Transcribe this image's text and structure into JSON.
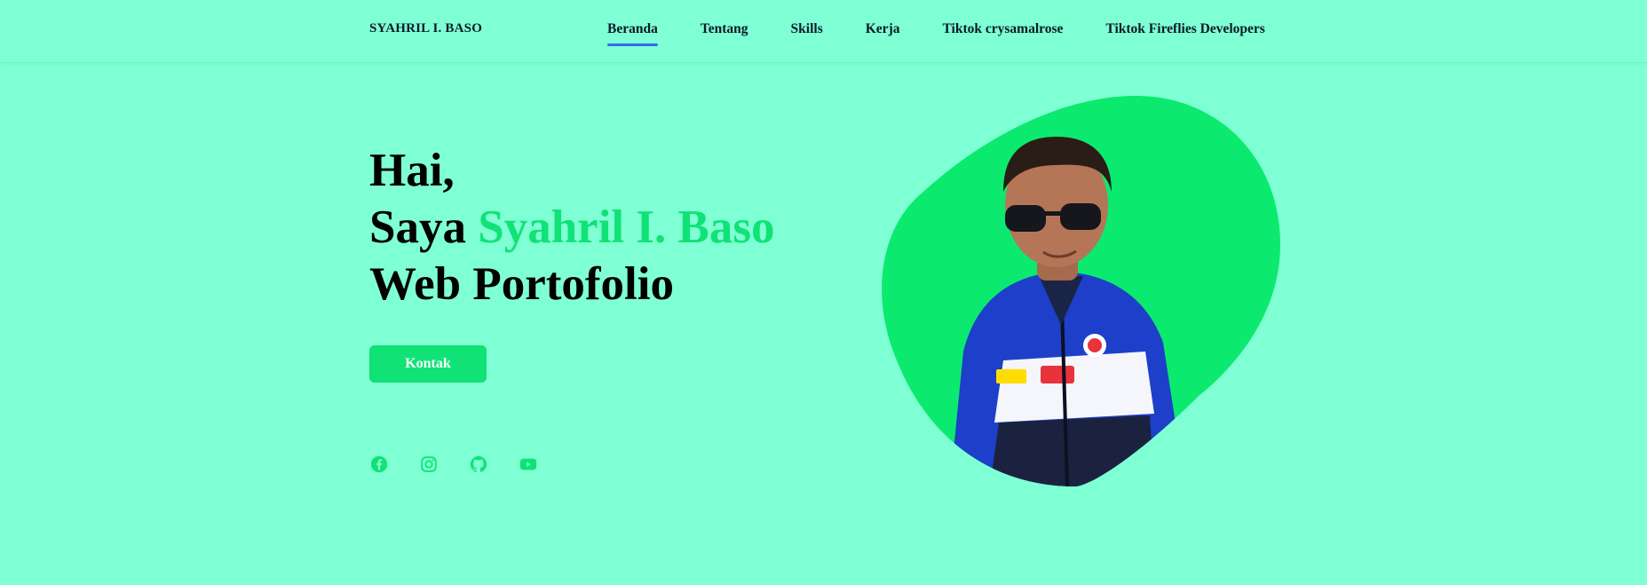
{
  "brand": "SYAHRIL I. BASO",
  "nav": {
    "items": [
      {
        "label": "Beranda",
        "active": true
      },
      {
        "label": "Tentang"
      },
      {
        "label": "Skills"
      },
      {
        "label": "Kerja"
      },
      {
        "label": "Tiktok crysamalrose"
      },
      {
        "label": "Tiktok Fireflies Developers"
      }
    ]
  },
  "hero": {
    "greeting": "Hai,",
    "intro_prefix": "Saya ",
    "name": "Syahril I. Baso",
    "role": "Web Portofolio",
    "cta_label": "Kontak"
  },
  "socials": {
    "icons": [
      "facebook-icon",
      "instagram-icon",
      "github-icon",
      "youtube-icon"
    ]
  },
  "colors": {
    "background": "#7fffd4",
    "accent": "#10e276",
    "nav_underline": "#3568f5",
    "text": "#0b1a2a"
  }
}
